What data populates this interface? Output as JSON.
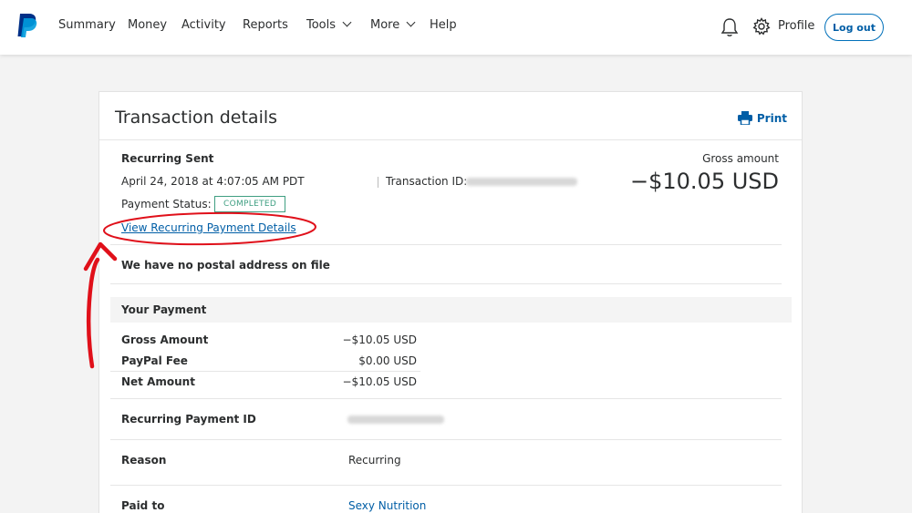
{
  "nav": {
    "items": [
      "Summary",
      "Money",
      "Activity",
      "Reports",
      "Tools",
      "More",
      "Help"
    ],
    "profile": "Profile",
    "logout": "Log out"
  },
  "card": {
    "title": "Transaction details",
    "print": "Print"
  },
  "transaction": {
    "type": "Recurring Sent",
    "datetime": "April 24, 2018 at 4:07:05 AM PDT",
    "id_label": "Transaction ID:",
    "status_label": "Payment Status:",
    "status": "COMPLETED",
    "recurring_link": "View Recurring Payment Details",
    "gross_label": "Gross amount",
    "gross_amount": "−$10.05 USD",
    "postal_note": "We have no postal address on file"
  },
  "payment": {
    "section_title": "Your Payment",
    "rows": [
      {
        "label": "Gross Amount",
        "value": "−$10.05 USD"
      },
      {
        "label": "PayPal Fee",
        "value": "$0.00 USD"
      },
      {
        "label": "Net Amount",
        "value": "−$10.05 USD"
      }
    ],
    "recurring_id_label": "Recurring Payment ID",
    "reason_label": "Reason",
    "reason_value": "Recurring",
    "paid_to_label": "Paid to",
    "paid_to_value": "Sexy Nutrition"
  },
  "colors": {
    "accent": "#005ea6",
    "status_green": "#3f9f82",
    "annotation_red": "#e0101a"
  }
}
